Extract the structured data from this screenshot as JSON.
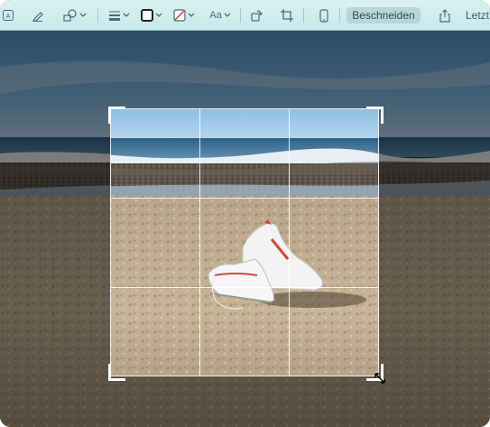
{
  "toolbar": {
    "crop_label": "Beschneiden",
    "last_label": "Letzt",
    "text_style_label": "Aa"
  },
  "icons": [
    "sidebar-icon",
    "pen-markup-icon",
    "shapes-icon",
    "line-style-icon",
    "border-color-icon",
    "fill-color-icon",
    "text-style-icon",
    "rotate-icon",
    "crop-icon",
    "device-icon",
    "share-icon"
  ],
  "crop_grid": {
    "rows": 3,
    "columns": 3
  },
  "colors": {
    "toolbar_bg": "#cfeaea",
    "crop_button_bg": "#b7d6d9",
    "accent_red": "#d8453a"
  }
}
